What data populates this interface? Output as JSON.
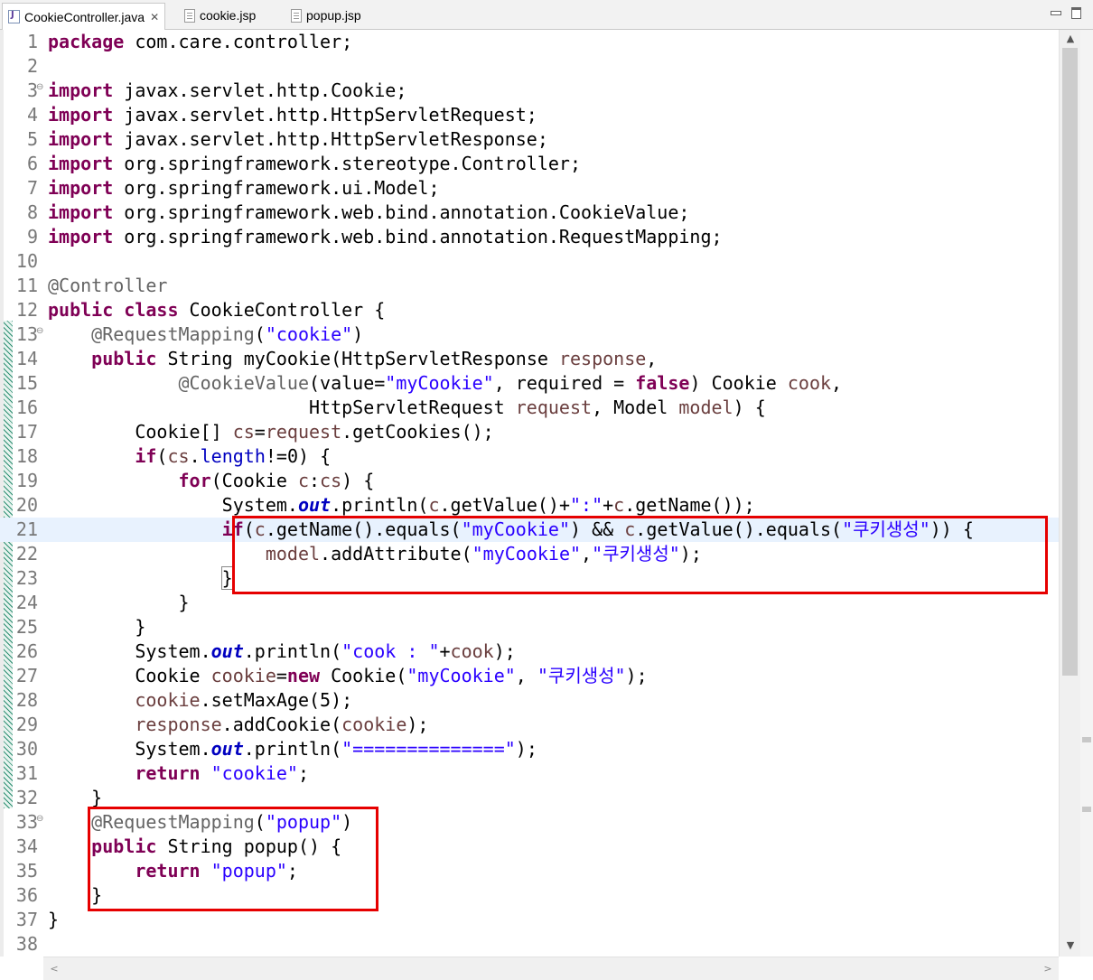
{
  "tabs": [
    {
      "label": "CookieController.java",
      "icon": "java-file-icon",
      "close": "✕",
      "active": true
    },
    {
      "label": "cookie.jsp",
      "icon": "jsp-file-icon",
      "active": false
    },
    {
      "label": "popup.jsp",
      "icon": "jsp-file-icon",
      "active": false
    }
  ],
  "editor": {
    "current_line": 21,
    "fold_marker": "⊖",
    "lines": [
      {
        "n": "1",
        "code": [
          [
            "k",
            "package"
          ],
          [
            "t",
            " com.care.controller;"
          ]
        ]
      },
      {
        "n": "2",
        "code": []
      },
      {
        "n": "3",
        "fold": true,
        "code": [
          [
            "k",
            "import"
          ],
          [
            "t",
            " javax.servlet.http.Cookie;"
          ]
        ]
      },
      {
        "n": "4",
        "code": [
          [
            "k",
            "import"
          ],
          [
            "t",
            " javax.servlet.http.HttpServletRequest;"
          ]
        ]
      },
      {
        "n": "5",
        "code": [
          [
            "k",
            "import"
          ],
          [
            "t",
            " javax.servlet.http.HttpServletResponse;"
          ]
        ]
      },
      {
        "n": "6",
        "code": [
          [
            "k",
            "import"
          ],
          [
            "t",
            " org.springframework.stereotype.Controller;"
          ]
        ]
      },
      {
        "n": "7",
        "code": [
          [
            "k",
            "import"
          ],
          [
            "t",
            " org.springframework.ui.Model;"
          ]
        ]
      },
      {
        "n": "8",
        "code": [
          [
            "k",
            "import"
          ],
          [
            "t",
            " org.springframework.web.bind.annotation.CookieValue;"
          ]
        ]
      },
      {
        "n": "9",
        "code": [
          [
            "k",
            "import"
          ],
          [
            "t",
            " org.springframework.web.bind.annotation.RequestMapping;"
          ]
        ]
      },
      {
        "n": "10",
        "code": []
      },
      {
        "n": "11",
        "code": [
          [
            "a",
            "@Controller"
          ]
        ]
      },
      {
        "n": "12",
        "code": [
          [
            "k",
            "public"
          ],
          [
            "t",
            " "
          ],
          [
            "k",
            "class"
          ],
          [
            "t",
            " CookieController {"
          ]
        ]
      },
      {
        "n": "13",
        "fold": true,
        "code": [
          [
            "t",
            "    "
          ],
          [
            "a",
            "@RequestMapping"
          ],
          [
            "t",
            "("
          ],
          [
            "s",
            "\"cookie\""
          ],
          [
            "t",
            ")"
          ]
        ]
      },
      {
        "n": "14",
        "code": [
          [
            "t",
            "    "
          ],
          [
            "k",
            "public"
          ],
          [
            "t",
            " String myCookie(HttpServletResponse "
          ],
          [
            "v",
            "response"
          ],
          [
            "t",
            ","
          ]
        ]
      },
      {
        "n": "15",
        "code": [
          [
            "t",
            "            "
          ],
          [
            "a",
            "@CookieValue"
          ],
          [
            "t",
            "(value="
          ],
          [
            "s",
            "\"myCookie\""
          ],
          [
            "t",
            ", required = "
          ],
          [
            "k",
            "false"
          ],
          [
            "t",
            ") Cookie "
          ],
          [
            "v",
            "cook"
          ],
          [
            "t",
            ","
          ]
        ]
      },
      {
        "n": "16",
        "code": [
          [
            "t",
            "                        HttpServletRequest "
          ],
          [
            "v",
            "request"
          ],
          [
            "t",
            ", Model "
          ],
          [
            "v",
            "model"
          ],
          [
            "t",
            ") {"
          ]
        ]
      },
      {
        "n": "17",
        "code": [
          [
            "t",
            "        Cookie[] "
          ],
          [
            "v",
            "cs"
          ],
          [
            "t",
            "="
          ],
          [
            "v",
            "request"
          ],
          [
            "t",
            ".getCookies();"
          ]
        ]
      },
      {
        "n": "18",
        "code": [
          [
            "t",
            "        "
          ],
          [
            "k",
            "if"
          ],
          [
            "t",
            "("
          ],
          [
            "v",
            "cs"
          ],
          [
            "t",
            "."
          ],
          [
            "f",
            "length"
          ],
          [
            "t",
            "!=0) {"
          ]
        ]
      },
      {
        "n": "19",
        "code": [
          [
            "t",
            "            "
          ],
          [
            "k",
            "for"
          ],
          [
            "t",
            "(Cookie "
          ],
          [
            "v",
            "c"
          ],
          [
            "t",
            ":"
          ],
          [
            "v",
            "cs"
          ],
          [
            "t",
            ") {"
          ]
        ]
      },
      {
        "n": "20",
        "code": [
          [
            "t",
            "                System."
          ],
          [
            "i",
            "out"
          ],
          [
            "t",
            ".println("
          ],
          [
            "v",
            "c"
          ],
          [
            "t",
            ".getValue()+"
          ],
          [
            "s",
            "\":\""
          ],
          [
            "t",
            "+"
          ],
          [
            "v",
            "c"
          ],
          [
            "t",
            ".getName());"
          ]
        ]
      },
      {
        "n": "21",
        "code": [
          [
            "t",
            "                "
          ],
          [
            "k",
            "if"
          ],
          [
            "t",
            "("
          ],
          [
            "v",
            "c"
          ],
          [
            "t",
            ".getName().equals("
          ],
          [
            "s",
            "\"myCookie\""
          ],
          [
            "t",
            ") && "
          ],
          [
            "v",
            "c"
          ],
          [
            "t",
            ".getValue().equals("
          ],
          [
            "s",
            "\"쿠키생성\""
          ],
          [
            "t",
            ")) {"
          ]
        ]
      },
      {
        "n": "22",
        "code": [
          [
            "t",
            "                    "
          ],
          [
            "v",
            "model"
          ],
          [
            "t",
            ".addAttribute("
          ],
          [
            "s",
            "\"myCookie\""
          ],
          [
            "t",
            ","
          ],
          [
            "s",
            "\"쿠키생성\""
          ],
          [
            "t",
            ");"
          ]
        ]
      },
      {
        "n": "23",
        "code": [
          [
            "t",
            "                "
          ],
          [
            "b",
            "}"
          ]
        ]
      },
      {
        "n": "24",
        "code": [
          [
            "t",
            "            }"
          ]
        ]
      },
      {
        "n": "25",
        "code": [
          [
            "t",
            "        }"
          ]
        ]
      },
      {
        "n": "26",
        "code": [
          [
            "t",
            "        System."
          ],
          [
            "i",
            "out"
          ],
          [
            "t",
            ".println("
          ],
          [
            "s",
            "\"cook : \""
          ],
          [
            "t",
            "+"
          ],
          [
            "v",
            "cook"
          ],
          [
            "t",
            ");"
          ]
        ]
      },
      {
        "n": "27",
        "code": [
          [
            "t",
            "        Cookie "
          ],
          [
            "v",
            "cookie"
          ],
          [
            "t",
            "="
          ],
          [
            "k",
            "new"
          ],
          [
            "t",
            " Cookie("
          ],
          [
            "s",
            "\"myCookie\""
          ],
          [
            "t",
            ", "
          ],
          [
            "s",
            "\"쿠키생성\""
          ],
          [
            "t",
            ");"
          ]
        ]
      },
      {
        "n": "28",
        "code": [
          [
            "t",
            "        "
          ],
          [
            "v",
            "cookie"
          ],
          [
            "t",
            ".setMaxAge(5);"
          ]
        ]
      },
      {
        "n": "29",
        "code": [
          [
            "t",
            "        "
          ],
          [
            "v",
            "response"
          ],
          [
            "t",
            ".addCookie("
          ],
          [
            "v",
            "cookie"
          ],
          [
            "t",
            ");"
          ]
        ]
      },
      {
        "n": "30",
        "code": [
          [
            "t",
            "        System."
          ],
          [
            "i",
            "out"
          ],
          [
            "t",
            ".println("
          ],
          [
            "s",
            "\"==============\""
          ],
          [
            "t",
            ");"
          ]
        ]
      },
      {
        "n": "31",
        "code": [
          [
            "t",
            "        "
          ],
          [
            "k",
            "return"
          ],
          [
            "t",
            " "
          ],
          [
            "s",
            "\"cookie\""
          ],
          [
            "t",
            ";"
          ]
        ]
      },
      {
        "n": "32",
        "code": [
          [
            "t",
            "    }"
          ]
        ]
      },
      {
        "n": "33",
        "fold": true,
        "code": [
          [
            "t",
            "    "
          ],
          [
            "a",
            "@RequestMapping"
          ],
          [
            "t",
            "("
          ],
          [
            "s",
            "\"popup\""
          ],
          [
            "t",
            ")"
          ]
        ]
      },
      {
        "n": "34",
        "code": [
          [
            "t",
            "    "
          ],
          [
            "k",
            "public"
          ],
          [
            "t",
            " String popup() {"
          ]
        ]
      },
      {
        "n": "35",
        "code": [
          [
            "t",
            "        "
          ],
          [
            "k",
            "return"
          ],
          [
            "t",
            " "
          ],
          [
            "s",
            "\"popup\""
          ],
          [
            "t",
            ";"
          ]
        ]
      },
      {
        "n": "36",
        "code": [
          [
            "t",
            "    }"
          ]
        ]
      },
      {
        "n": "37",
        "code": [
          [
            "t",
            "}"
          ]
        ]
      },
      {
        "n": "38",
        "code": []
      }
    ]
  },
  "annotations": [
    {
      "name": "highlight-if-block",
      "color": "#e60000"
    },
    {
      "name": "highlight-popup-method",
      "color": "#e60000"
    }
  ],
  "scrollbars": {
    "up": "▲",
    "down": "▼",
    "left": "<",
    "right": ">"
  }
}
